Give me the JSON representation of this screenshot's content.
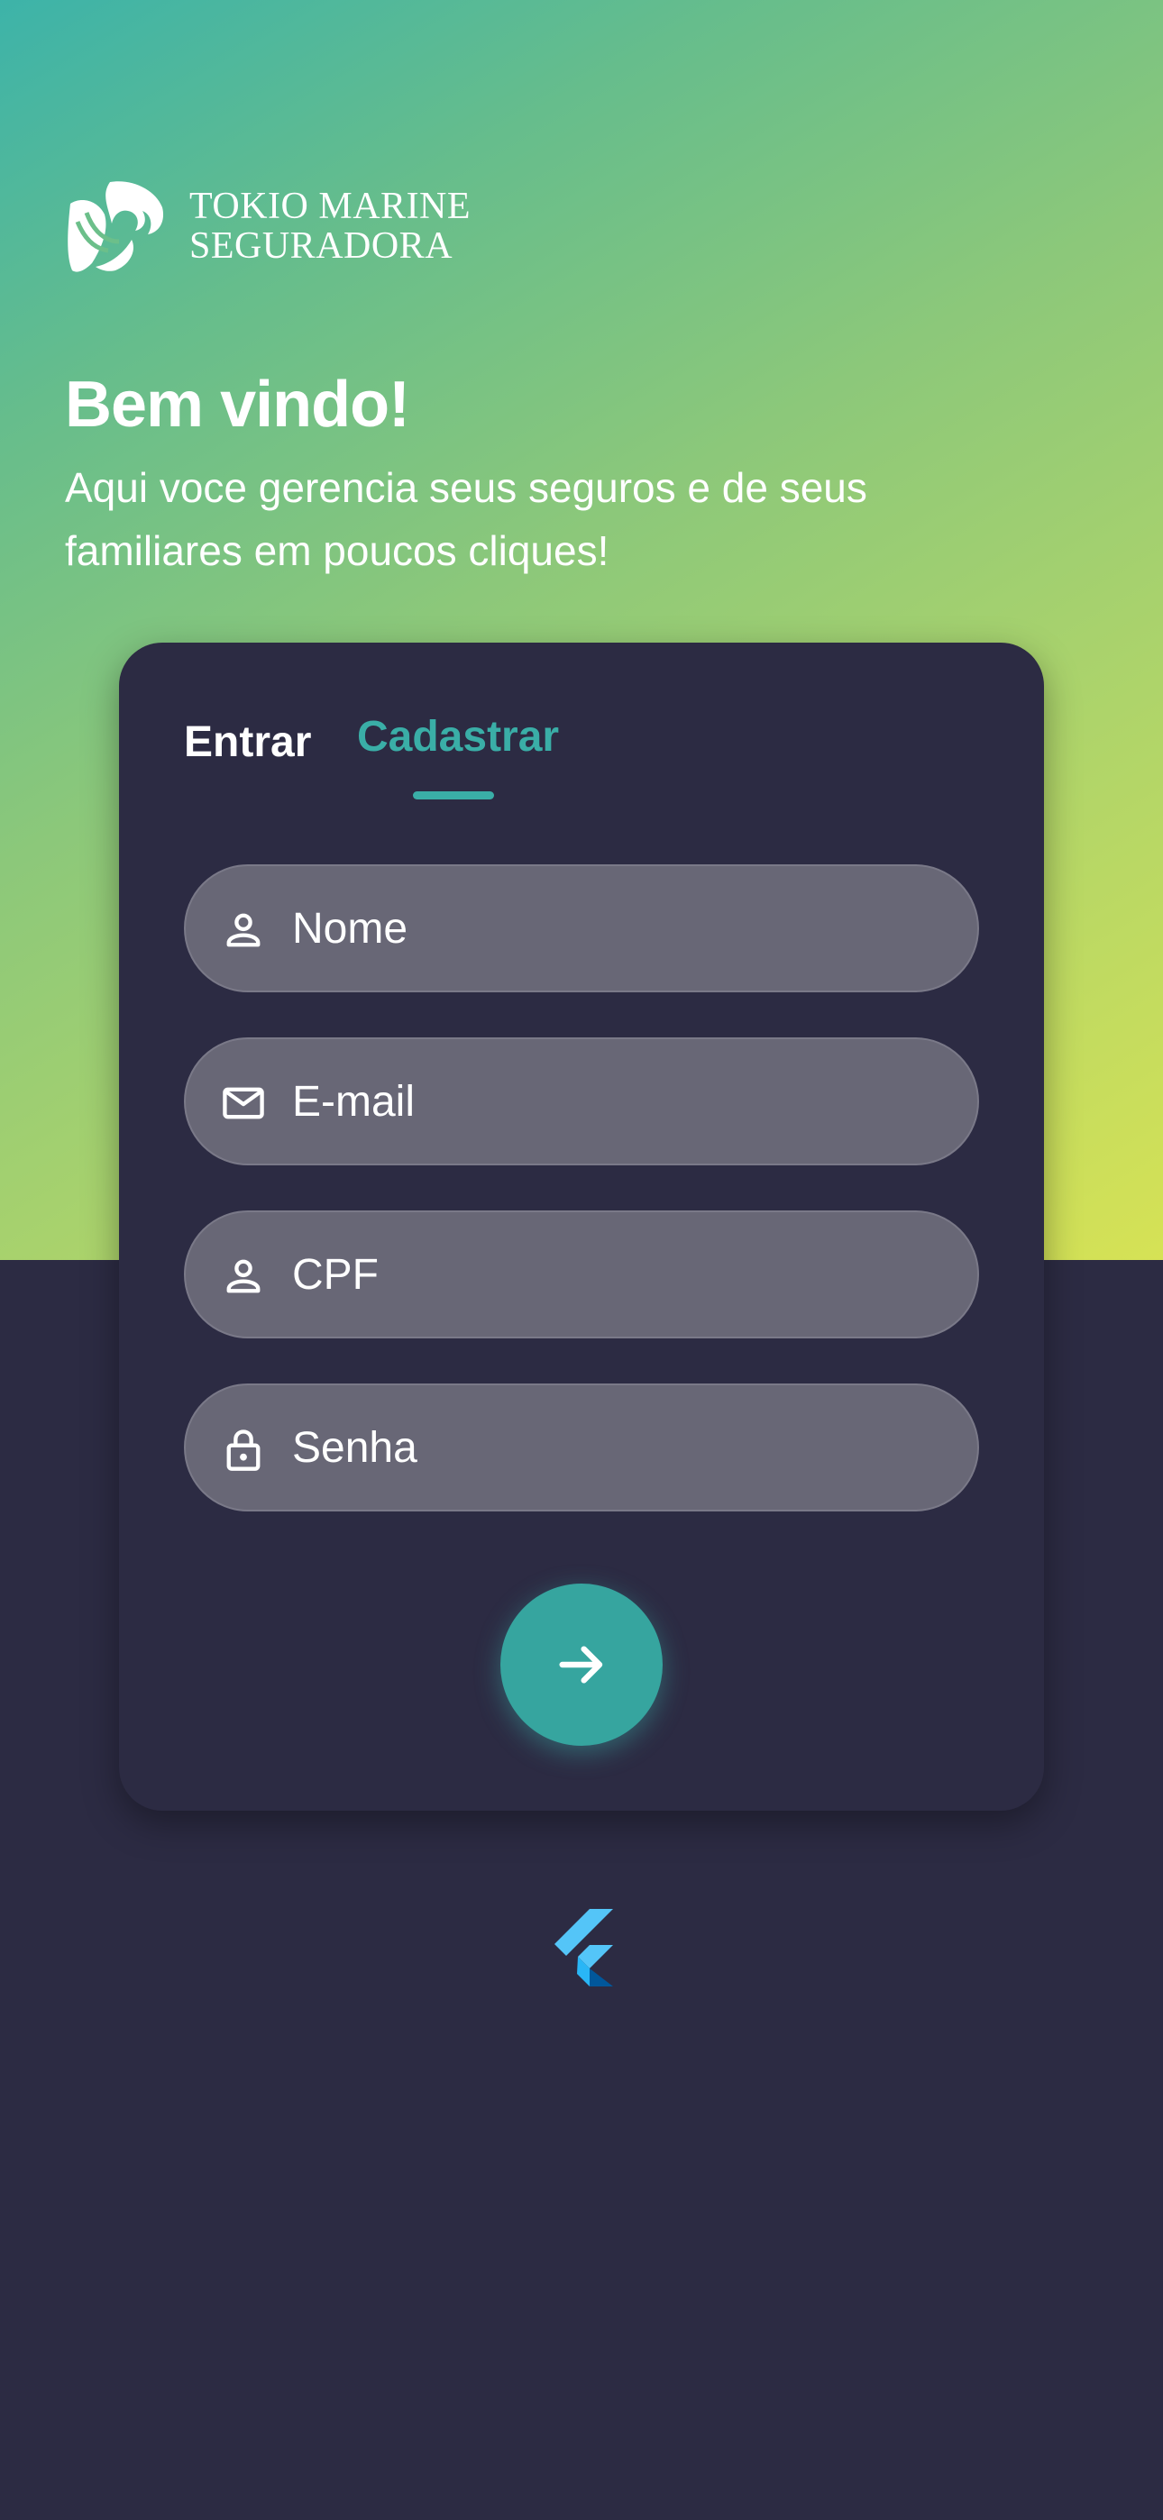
{
  "brand": {
    "line1": "TOKIO MARINE",
    "line2": "SEGURADORA"
  },
  "welcome": {
    "title": "Bem vindo!",
    "subtitle": "Aqui voce gerencia seus seguros e de seus familiares em poucos cliques!"
  },
  "tabs": {
    "login_label": "Entrar",
    "signup_label": "Cadastrar",
    "active": "signup"
  },
  "form": {
    "name": {
      "placeholder": "Nome",
      "value": "",
      "icon": "person-icon"
    },
    "email": {
      "placeholder": "E-mail",
      "value": "",
      "icon": "mail-icon"
    },
    "cpf": {
      "placeholder": "CPF",
      "value": "",
      "icon": "person-icon"
    },
    "password": {
      "placeholder": "Senha",
      "value": "",
      "icon": "lock-icon"
    },
    "submit_icon": "arrow-right-icon"
  },
  "footer": {
    "icon": "flutter-logo-icon"
  },
  "colors": {
    "accent": "#3aaea7",
    "background": "#2c2b43",
    "field": "#686776",
    "gradient_start": "#3db3a9",
    "gradient_end": "#d6e255"
  }
}
